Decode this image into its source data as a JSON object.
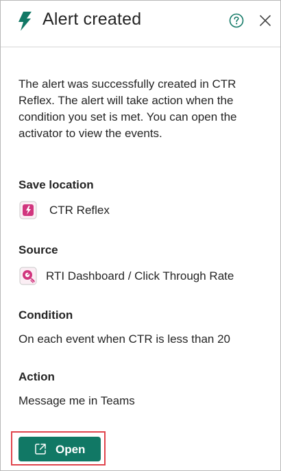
{
  "header": {
    "title": "Alert created",
    "icons": {
      "leading": "lightning-bolt-icon",
      "help": "help-circle-icon",
      "close": "close-icon"
    }
  },
  "description": "The alert was successfully created in CTR Reflex. The alert will take action when the condition you set is met. You can open the activator to view the events.",
  "save_location": {
    "label": "Save location",
    "value": "CTR Reflex",
    "icon": "reflex-icon"
  },
  "source": {
    "label": "Source",
    "value": "RTI Dashboard / Click Through Rate",
    "icon": "realtime-dashboard-icon"
  },
  "condition": {
    "label": "Condition",
    "value": "On each event when CTR is less than 20"
  },
  "action": {
    "label": "Action",
    "value": "Message me in Teams"
  },
  "footer": {
    "open_label": "Open",
    "open_icon": "open-external-icon"
  },
  "colors": {
    "accent": "#117865",
    "highlight_border": "#e0434b",
    "reflex": "#d1357e"
  }
}
